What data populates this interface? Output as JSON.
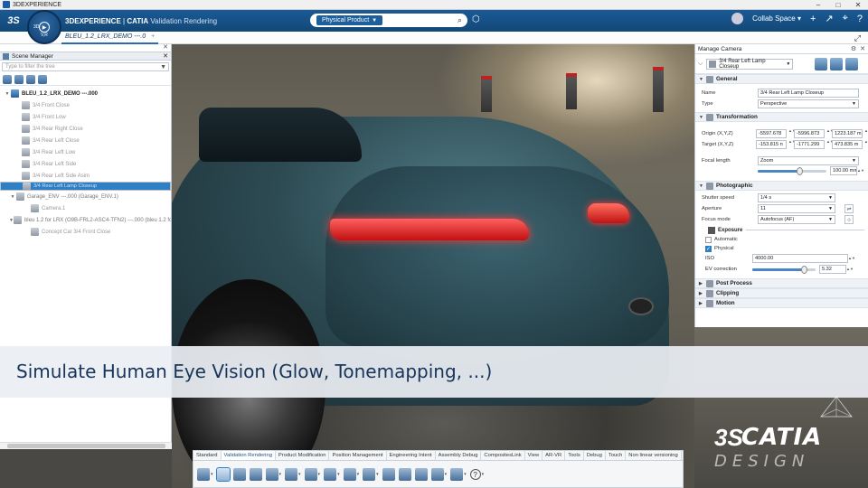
{
  "os_bar": {
    "title": "3DEXPERIENCE",
    "controls": [
      "–",
      "□",
      "✕"
    ]
  },
  "top_bar": {
    "brand": "3DEXPERIENCE",
    "separator": " | ",
    "app": "CATIA",
    "sub": "Validation Rendering",
    "search_tag": "Physical Product",
    "collab_space": "Collab Space"
  },
  "compass": {
    "left": "3D",
    "bottom": "V,R"
  },
  "doc_tab": {
    "label": "BLEU_1.2_LRX_DEMO ---.0",
    "plus": "+"
  },
  "scene_manager": {
    "title": "Scene Manager",
    "filter_placeholder": "Type to filter the tree",
    "tree": [
      {
        "label": "BLEU_1.2_LRX_DEMO ---.000",
        "kind": "root",
        "exp": "▼"
      },
      {
        "label": "3/4 Front Close",
        "kind": "item"
      },
      {
        "label": "3/4 Front Low",
        "kind": "item"
      },
      {
        "label": "3/4 Rear Right Close",
        "kind": "item"
      },
      {
        "label": "3/4 Rear Left Close",
        "kind": "item"
      },
      {
        "label": "3/4 Rear Left Low",
        "kind": "item"
      },
      {
        "label": "3/4 Rear Left Side",
        "kind": "item"
      },
      {
        "label": "3/4 Rear Left Side Asim",
        "kind": "item"
      },
      {
        "label": "3/4 Rear Left Lamp Closeup",
        "kind": "selected"
      },
      {
        "label": "Garage_ENV ---.000 (Garage_ENV.1)",
        "kind": "group",
        "exp": "▼"
      },
      {
        "label": "Camera.1",
        "kind": "sub"
      },
      {
        "label": "bleu 1.2 for LRX (O9B-FRL2-ASC4-TFN2) ---.000 (bleu 1.2 fo",
        "kind": "group-dark",
        "exp": "▼"
      },
      {
        "label": "Concept Car 3/4 Front Close",
        "kind": "sub"
      }
    ]
  },
  "manage_camera": {
    "title": "Manage Camera",
    "camera_select": "3/4 Rear Left Lamp Closeup",
    "general": {
      "header": "General",
      "name_label": "Name",
      "name_value": "3/4 Rear Left Lamp Closeup",
      "type_label": "Type",
      "type_value": "Perspective"
    },
    "transformation": {
      "header": "Transformation",
      "origin_label": "Origin (X,Y,Z)",
      "origin": [
        "-5597.678",
        "-5996.873",
        "1223.187 m"
      ],
      "target_label": "Target (X,Y,Z)",
      "target": [
        "-153.815 n",
        "-1771.299",
        "473.835 m"
      ],
      "focal_label": "Focal length",
      "focal_mode": "Zoom",
      "focal_value": "100.00 mm",
      "focal_slider": 0.6
    },
    "photographic": {
      "header": "Photographic",
      "shutter_label": "Shutter speed",
      "shutter_value": "1/4 s",
      "aperture_label": "Aperture",
      "aperture_value": "11",
      "focus_label": "Focus mode",
      "focus_value": "Autofocus (AF)",
      "exposure_header": "Exposure",
      "automatic_label": "Automatic",
      "physical_label": "Physical",
      "iso_label": "ISO",
      "iso_value": "4000.00",
      "ev_label": "EV correction",
      "ev_value": "5.32",
      "ev_slider": 0.82
    },
    "post_process": "Post Process",
    "clipping": "Clipping",
    "motion": "Motion"
  },
  "banner": {
    "text": "Simulate Human Eye Vision (Glow, Tonemapping, ...)"
  },
  "bottom_tabs": [
    "Standard",
    "Validation Rendering",
    "Product Modification",
    "Position Management",
    "Engineering Intent",
    "Assembly Debug",
    "CompositesLink",
    "View",
    "AR-VR",
    "Tools",
    "Debug",
    "Touch",
    "Non linear versioning"
  ],
  "bottom_active_tab": "Validation Rendering",
  "brand": {
    "ds": "3S",
    "catia": "CATIA",
    "design": "DESIGN"
  }
}
